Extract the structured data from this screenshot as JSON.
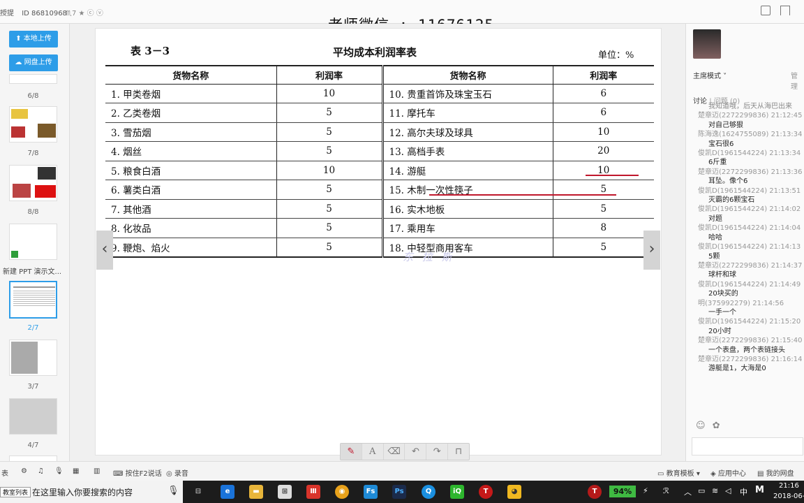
{
  "topbar": {
    "room_prefix": "授提",
    "room_id": "ID 86810968",
    "room_meta": "♏7 ★ ⓒ ⓥ",
    "watermark": "老师微信 : 11676125"
  },
  "sidebar": {
    "upload_local": "本地上传",
    "upload_cloud": "网盘上传",
    "slides": [
      {
        "label": "6/8"
      },
      {
        "label": "7/8"
      },
      {
        "label": "8/8"
      },
      {
        "label": "新建 PPT 演示文..."
      },
      {
        "label": "2/7"
      },
      {
        "label": "3/7"
      },
      {
        "label": "4/7"
      }
    ]
  },
  "slide": {
    "table_number": "表 3－3",
    "table_title": "平均成本利润率表",
    "unit": "单位：%",
    "headers": [
      "货物名称",
      "利润率",
      "货物名称",
      "利润率"
    ],
    "rows": [
      {
        "left_name": "1.  甲类卷烟",
        "left_rate": "10",
        "right_name": "10.  贵重首饰及珠宝玉石",
        "right_rate": "6"
      },
      {
        "left_name": "2.  乙类卷烟",
        "left_rate": "5",
        "right_name": "11.  摩托车",
        "right_rate": "6"
      },
      {
        "left_name": "3.  雪茄烟",
        "left_rate": "5",
        "right_name": "12.  高尔夫球及球具",
        "right_rate": "10"
      },
      {
        "left_name": "4.  烟丝",
        "left_rate": "5",
        "right_name": "13.  高档手表",
        "right_rate": "20"
      },
      {
        "left_name": "5.  粮食白酒",
        "left_rate": "10",
        "right_name": "14.  游艇",
        "right_rate": "10"
      },
      {
        "left_name": "6.  薯类白酒",
        "left_rate": "5",
        "right_name": "15.  木制一次性筷子",
        "right_rate": "5"
      },
      {
        "left_name": "7.  其他酒",
        "left_rate": "5",
        "right_name": "16.  实木地板",
        "right_rate": "5"
      },
      {
        "left_name": "8.  化妆品",
        "left_rate": "5",
        "right_name": "17.  乘用车",
        "right_rate": "8"
      },
      {
        "left_name": "9.  鞭炮、焰火",
        "left_rate": "5",
        "right_name": "18.  中轻型商用客车",
        "right_rate": "5"
      }
    ],
    "ocr_watermark": "东 拉 斯",
    "prev_arrow": "‹",
    "next_arrow": "›"
  },
  "drawing_tools": [
    "pen-icon",
    "text-icon",
    "eraser-icon",
    "undo-icon",
    "redo-icon",
    "lock-icon"
  ],
  "right_panel": {
    "mode": "主席模式 ˅",
    "manage": "管理",
    "tab_discuss": "讨论",
    "tab_question": "问题",
    "question_count": "(0)",
    "messages": [
      {
        "who": "",
        "text": "我知道哦，后天从海巴出来"
      },
      {
        "who": "楚章迈(2272299836) 21:12:45",
        "text": "对自己够狠"
      },
      {
        "who": "陈海逸(1624755089) 21:13:34",
        "text": "宝石很6"
      },
      {
        "who": "俊凯D(1961544224) 21:13:34",
        "text": "6斤重"
      },
      {
        "who": "楚章迈(2272299836) 21:13:36",
        "text": "耳坠。像个6"
      },
      {
        "who": "俊凯D(1961544224) 21:13:51",
        "text": "灭霸的6颗宝石"
      },
      {
        "who": "俊凯D(1961544224) 21:14:02",
        "text": "对题"
      },
      {
        "who": "俊凯D(1961544224) 21:14:04",
        "text": "哈哈"
      },
      {
        "who": "俊凯D(1961544224) 21:14:13",
        "text": "5颗"
      },
      {
        "who": "楚章迈(2272299836) 21:14:37",
        "text": "球杆和球"
      },
      {
        "who": "俊凯D(1961544224) 21:14:49",
        "text": "20块买的"
      },
      {
        "who": "明(375992279) 21:14:56",
        "text": "一手一个"
      },
      {
        "who": "俊凯D(1961544224) 21:15:20",
        "text": "20小时"
      },
      {
        "who": "楚章迈(2272299836) 21:15:40",
        "text": "一个表盘，两个表链接头"
      },
      {
        "who": "楚章迈(2272299836) 21:16:14",
        "text": "游艇是1，大海是0"
      }
    ]
  },
  "statusbar": {
    "left_items": [
      "表",
      "⚙",
      "♫",
      "🎙",
      "▦",
      "▥"
    ],
    "hold_f2": "按住F2说话",
    "record": "录音",
    "edu_template": "教育模板 ▾",
    "app_center": "应用中心",
    "my_cloud": "我的网盘"
  },
  "taskbar": {
    "tooltip": "教室列表",
    "search_placeholder": "在这里输入你要搜索的内容",
    "battery": "94%",
    "ime": "中",
    "time": "21:16",
    "date": "2018-06-"
  }
}
